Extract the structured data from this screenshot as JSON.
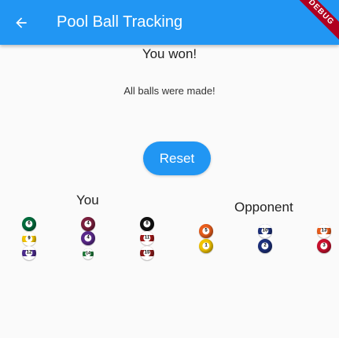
{
  "appbar": {
    "title": "Pool Ball Tracking",
    "back_icon": "arrow-back-icon",
    "color": "#2196f3",
    "debug_label": "DEBUG"
  },
  "status": {
    "message": "You won!",
    "detail": "All balls were made!"
  },
  "reset_label": "Reset",
  "players": {
    "you_label": "You",
    "opponent_label": "Opponent"
  },
  "balls": {
    "you": [
      {
        "number": "6",
        "color": "#006b3c",
        "stripe": false
      },
      {
        "number": "9",
        "color": "#f2c400",
        "stripe": true
      },
      {
        "number": "12",
        "color": "#4b2a8c",
        "stripe": true
      },
      {
        "number": "4",
        "color": "#7a1f3d",
        "stripe": false
      },
      {
        "number": "4",
        "color": "#5a2a8a",
        "stripe": false
      },
      {
        "number": "14",
        "color": "#1f7a3a",
        "stripe": true
      },
      {
        "number": "8",
        "color": "#111111",
        "stripe": false
      },
      {
        "number": "11",
        "color": "#a01818",
        "stripe": true
      },
      {
        "number": "15",
        "color": "#8b1a1a",
        "stripe": true
      }
    ],
    "opponent": [
      {
        "number": "5",
        "color": "#e85d1c",
        "stripe": false
      },
      {
        "number": "1",
        "color": "#f2c400",
        "stripe": false
      },
      {
        "number": "10",
        "color": "#1c2f7a",
        "stripe": true
      },
      {
        "number": "2",
        "color": "#1c2f7a",
        "stripe": false
      },
      {
        "number": "13",
        "color": "#e85d1c",
        "stripe": true
      },
      {
        "number": "3",
        "color": "#c8102e",
        "stripe": false
      }
    ]
  }
}
